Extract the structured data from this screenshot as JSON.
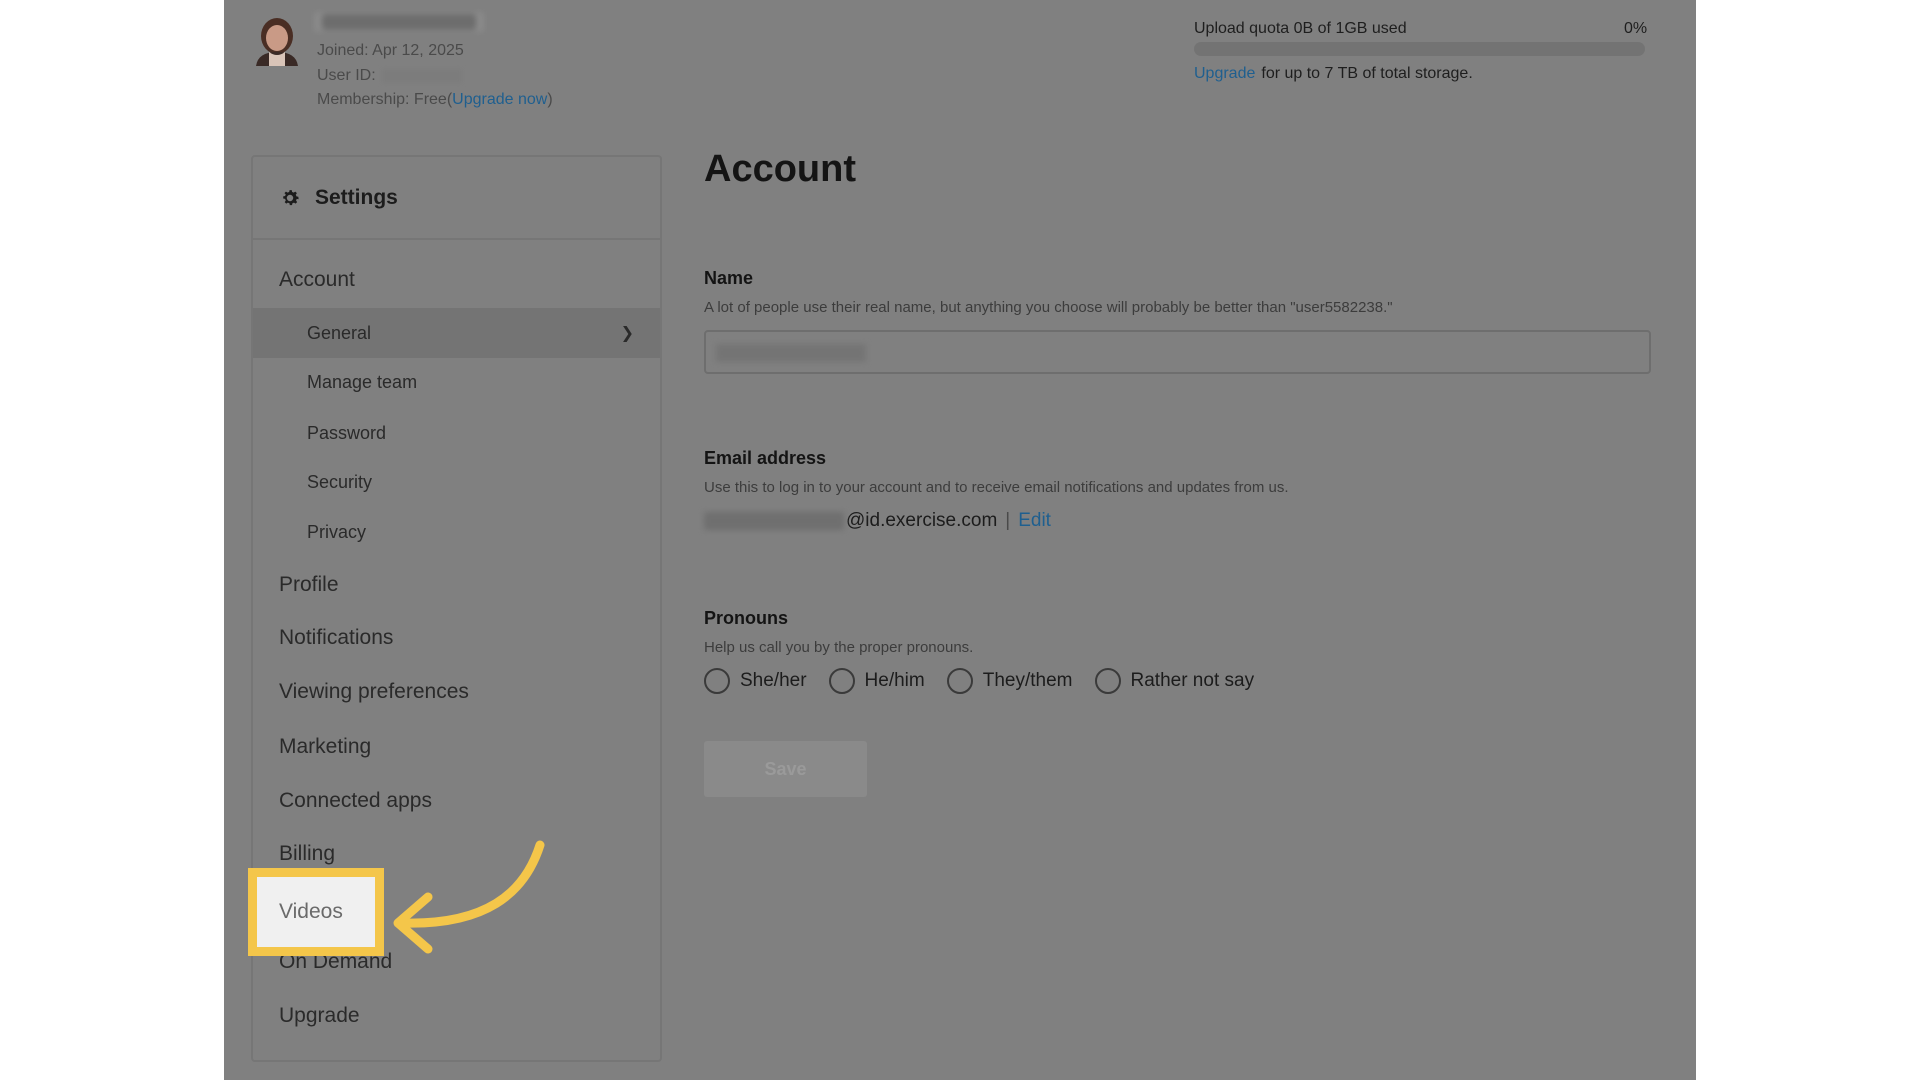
{
  "header": {
    "user_name": "",
    "joined": "Joined: Apr 12, 2025",
    "user_id_label": "User ID:",
    "membership_prefix": "Membership: Free(",
    "membership_link": "Upgrade now",
    "membership_suffix": ")",
    "quota": {
      "label": "Upload quota 0B of 1GB used",
      "percent_text": "0%",
      "percent_value": 0,
      "upgrade_link": "Upgrade",
      "note": "for up to 7 TB of total storage."
    }
  },
  "sidebar": {
    "title": "Settings",
    "icon": "gear-icon",
    "account_label": "Account",
    "account_subitems": [
      {
        "label": "General",
        "active": true
      },
      {
        "label": "Manage team"
      },
      {
        "label": "Password"
      },
      {
        "label": "Security"
      },
      {
        "label": "Privacy"
      }
    ],
    "items": [
      {
        "label": "Profile"
      },
      {
        "label": "Notifications"
      },
      {
        "label": "Viewing preferences"
      },
      {
        "label": "Marketing"
      },
      {
        "label": "Connected apps"
      },
      {
        "label": "Billing"
      },
      {
        "label": "Videos",
        "highlighted": true
      },
      {
        "label": "On Demand"
      },
      {
        "label": "Upgrade"
      }
    ]
  },
  "main": {
    "title": "Account",
    "name": {
      "label": "Name",
      "help": "A lot of people use their real name, but anything you choose will probably be better than \"user5582238.\""
    },
    "email": {
      "label": "Email address",
      "help": "Use this to log in to your account and to receive email notifications and updates from us.",
      "value_suffix": "@id.exercise.com",
      "separator": "|",
      "edit_label": "Edit"
    },
    "pronouns": {
      "label": "Pronouns",
      "help": "Help us call you by the proper pronouns.",
      "options": [
        "She/her",
        "He/him",
        "They/them",
        "Rather not say"
      ]
    },
    "save_label": "Save"
  },
  "colors": {
    "overlay": "#808080",
    "highlight": "#f4c64a",
    "link": "#1f5f8f"
  }
}
